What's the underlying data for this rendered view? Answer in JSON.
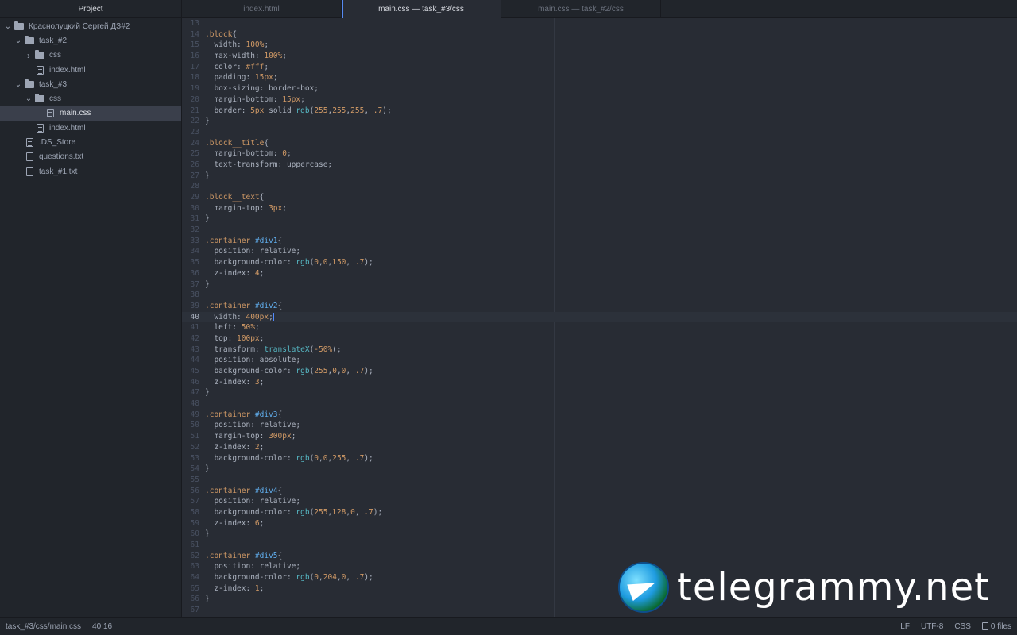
{
  "sidebar": {
    "title": "Project",
    "tree": [
      {
        "label": "Краснолуцкий Сергей ДЗ#2",
        "type": "folder",
        "depth": 0,
        "expanded": true,
        "selected": false
      },
      {
        "label": "task_#2",
        "type": "folder",
        "depth": 1,
        "expanded": true,
        "selected": false
      },
      {
        "label": "css",
        "type": "folder",
        "depth": 2,
        "expanded": false,
        "selected": false
      },
      {
        "label": "index.html",
        "type": "file",
        "depth": 2,
        "selected": false
      },
      {
        "label": "task_#3",
        "type": "folder",
        "depth": 1,
        "expanded": true,
        "selected": false
      },
      {
        "label": "css",
        "type": "folder",
        "depth": 2,
        "expanded": true,
        "selected": false
      },
      {
        "label": "main.css",
        "type": "file",
        "depth": 3,
        "selected": true
      },
      {
        "label": "index.html",
        "type": "file",
        "depth": 2,
        "selected": false
      },
      {
        "label": ".DS_Store",
        "type": "file",
        "depth": 1,
        "selected": false
      },
      {
        "label": "questions.txt",
        "type": "file",
        "depth": 1,
        "selected": false
      },
      {
        "label": "task_#1.txt",
        "type": "file",
        "depth": 1,
        "selected": false
      }
    ]
  },
  "tabs": [
    {
      "label": "index.html",
      "active": false
    },
    {
      "label": "main.css — task_#3/css",
      "active": true
    },
    {
      "label": "main.css — task_#2/css",
      "active": false
    }
  ],
  "editor": {
    "cursor_line": 40,
    "lines": [
      {
        "n": "13",
        "t": []
      },
      {
        "n": "14",
        "t": [
          [
            "sel",
            ".block"
          ],
          [
            "p",
            "{"
          ]
        ]
      },
      {
        "n": "15",
        "t": [
          [
            "prop",
            "  width: "
          ],
          [
            "num",
            "100%"
          ],
          [
            "p",
            ";"
          ]
        ]
      },
      {
        "n": "16",
        "t": [
          [
            "prop",
            "  max-width: "
          ],
          [
            "num",
            "100%"
          ],
          [
            "p",
            ";"
          ]
        ]
      },
      {
        "n": "17",
        "t": [
          [
            "prop",
            "  color: "
          ],
          [
            "num",
            "#fff"
          ],
          [
            "p",
            ";"
          ]
        ]
      },
      {
        "n": "18",
        "t": [
          [
            "prop",
            "  padding: "
          ],
          [
            "num",
            "15px"
          ],
          [
            "p",
            ";"
          ]
        ]
      },
      {
        "n": "19",
        "t": [
          [
            "prop",
            "  box-sizing: border-box;"
          ]
        ]
      },
      {
        "n": "20",
        "t": [
          [
            "prop",
            "  margin-bottom: "
          ],
          [
            "num",
            "15px"
          ],
          [
            "p",
            ";"
          ]
        ]
      },
      {
        "n": "21",
        "t": [
          [
            "prop",
            "  border: "
          ],
          [
            "num",
            "5px"
          ],
          [
            "prop",
            " solid "
          ],
          [
            "fn",
            "rgb"
          ],
          [
            "p",
            "("
          ],
          [
            "num",
            "255"
          ],
          [
            "p",
            ","
          ],
          [
            "num",
            "255"
          ],
          [
            "p",
            ","
          ],
          [
            "num",
            "255"
          ],
          [
            "p",
            ", "
          ],
          [
            "num",
            ".7"
          ],
          [
            "p",
            ");"
          ]
        ]
      },
      {
        "n": "22",
        "t": [
          [
            "p",
            "}"
          ]
        ]
      },
      {
        "n": "23",
        "t": []
      },
      {
        "n": "24",
        "t": [
          [
            "sel",
            ".block__title"
          ],
          [
            "p",
            "{"
          ]
        ]
      },
      {
        "n": "25",
        "t": [
          [
            "prop",
            "  margin-bottom: "
          ],
          [
            "num",
            "0"
          ],
          [
            "p",
            ";"
          ]
        ]
      },
      {
        "n": "26",
        "t": [
          [
            "prop",
            "  text-transform: uppercase;"
          ]
        ]
      },
      {
        "n": "27",
        "t": [
          [
            "p",
            "}"
          ]
        ]
      },
      {
        "n": "28",
        "t": []
      },
      {
        "n": "29",
        "t": [
          [
            "sel",
            ".block__text"
          ],
          [
            "p",
            "{"
          ]
        ]
      },
      {
        "n": "30",
        "t": [
          [
            "prop",
            "  margin-top: "
          ],
          [
            "num",
            "3px"
          ],
          [
            "p",
            ";"
          ]
        ]
      },
      {
        "n": "31",
        "t": [
          [
            "p",
            "}"
          ]
        ]
      },
      {
        "n": "32",
        "t": []
      },
      {
        "n": "33",
        "t": [
          [
            "sel",
            ".container "
          ],
          [
            "id",
            "#div1"
          ],
          [
            "p",
            "{"
          ]
        ]
      },
      {
        "n": "34",
        "t": [
          [
            "prop",
            "  position: relative;"
          ]
        ]
      },
      {
        "n": "35",
        "t": [
          [
            "prop",
            "  background-color: "
          ],
          [
            "fn",
            "rgb"
          ],
          [
            "p",
            "("
          ],
          [
            "num",
            "0"
          ],
          [
            "p",
            ","
          ],
          [
            "num",
            "0"
          ],
          [
            "p",
            ","
          ],
          [
            "num",
            "150"
          ],
          [
            "p",
            ", "
          ],
          [
            "num",
            ".7"
          ],
          [
            "p",
            ");"
          ]
        ]
      },
      {
        "n": "36",
        "t": [
          [
            "prop",
            "  z-index: "
          ],
          [
            "num",
            "4"
          ],
          [
            "p",
            ";"
          ]
        ]
      },
      {
        "n": "37",
        "t": [
          [
            "p",
            "}"
          ]
        ]
      },
      {
        "n": "38",
        "t": []
      },
      {
        "n": "39",
        "t": [
          [
            "sel",
            ".container "
          ],
          [
            "id",
            "#div2"
          ],
          [
            "p",
            "{"
          ]
        ]
      },
      {
        "n": "40",
        "t": [
          [
            "prop",
            "  width: "
          ],
          [
            "num",
            "400px"
          ],
          [
            "p",
            ";"
          ]
        ],
        "cursor": true
      },
      {
        "n": "41",
        "t": [
          [
            "prop",
            "  left: "
          ],
          [
            "num",
            "50%"
          ],
          [
            "p",
            ";"
          ]
        ]
      },
      {
        "n": "42",
        "t": [
          [
            "prop",
            "  top: "
          ],
          [
            "num",
            "100px"
          ],
          [
            "p",
            ";"
          ]
        ]
      },
      {
        "n": "43",
        "t": [
          [
            "prop",
            "  transform: "
          ],
          [
            "fn",
            "translateX"
          ],
          [
            "p",
            "("
          ],
          [
            "num",
            "-50%"
          ],
          [
            "p",
            ");"
          ]
        ]
      },
      {
        "n": "44",
        "t": [
          [
            "prop",
            "  position: absolute;"
          ]
        ]
      },
      {
        "n": "45",
        "t": [
          [
            "prop",
            "  background-color: "
          ],
          [
            "fn",
            "rgb"
          ],
          [
            "p",
            "("
          ],
          [
            "num",
            "255"
          ],
          [
            "p",
            ","
          ],
          [
            "num",
            "0"
          ],
          [
            "p",
            ","
          ],
          [
            "num",
            "0"
          ],
          [
            "p",
            ", "
          ],
          [
            "num",
            ".7"
          ],
          [
            "p",
            ");"
          ]
        ]
      },
      {
        "n": "46",
        "t": [
          [
            "prop",
            "  z-index: "
          ],
          [
            "num",
            "3"
          ],
          [
            "p",
            ";"
          ]
        ]
      },
      {
        "n": "47",
        "t": [
          [
            "p",
            "}"
          ]
        ]
      },
      {
        "n": "48",
        "t": []
      },
      {
        "n": "49",
        "t": [
          [
            "sel",
            ".container "
          ],
          [
            "id",
            "#div3"
          ],
          [
            "p",
            "{"
          ]
        ]
      },
      {
        "n": "50",
        "t": [
          [
            "prop",
            "  position: relative;"
          ]
        ]
      },
      {
        "n": "51",
        "t": [
          [
            "prop",
            "  margin-top: "
          ],
          [
            "num",
            "300px"
          ],
          [
            "p",
            ";"
          ]
        ]
      },
      {
        "n": "52",
        "t": [
          [
            "prop",
            "  z-index: "
          ],
          [
            "num",
            "2"
          ],
          [
            "p",
            ";"
          ]
        ]
      },
      {
        "n": "53",
        "t": [
          [
            "prop",
            "  background-color: "
          ],
          [
            "fn",
            "rgb"
          ],
          [
            "p",
            "("
          ],
          [
            "num",
            "0"
          ],
          [
            "p",
            ","
          ],
          [
            "num",
            "0"
          ],
          [
            "p",
            ","
          ],
          [
            "num",
            "255"
          ],
          [
            "p",
            ", "
          ],
          [
            "num",
            ".7"
          ],
          [
            "p",
            ");"
          ]
        ]
      },
      {
        "n": "54",
        "t": [
          [
            "p",
            "}"
          ]
        ]
      },
      {
        "n": "55",
        "t": []
      },
      {
        "n": "56",
        "t": [
          [
            "sel",
            ".container "
          ],
          [
            "id",
            "#div4"
          ],
          [
            "p",
            "{"
          ]
        ]
      },
      {
        "n": "57",
        "t": [
          [
            "prop",
            "  position: relative;"
          ]
        ]
      },
      {
        "n": "58",
        "t": [
          [
            "prop",
            "  background-color: "
          ],
          [
            "fn",
            "rgb"
          ],
          [
            "p",
            "("
          ],
          [
            "num",
            "255"
          ],
          [
            "p",
            ","
          ],
          [
            "num",
            "128"
          ],
          [
            "p",
            ","
          ],
          [
            "num",
            "0"
          ],
          [
            "p",
            ", "
          ],
          [
            "num",
            ".7"
          ],
          [
            "p",
            ");"
          ]
        ]
      },
      {
        "n": "59",
        "t": [
          [
            "prop",
            "  z-index: "
          ],
          [
            "num",
            "6"
          ],
          [
            "p",
            ";"
          ]
        ]
      },
      {
        "n": "60",
        "t": [
          [
            "p",
            "}"
          ]
        ]
      },
      {
        "n": "61",
        "t": []
      },
      {
        "n": "62",
        "t": [
          [
            "sel",
            ".container "
          ],
          [
            "id",
            "#div5"
          ],
          [
            "p",
            "{"
          ]
        ]
      },
      {
        "n": "63",
        "t": [
          [
            "prop",
            "  position: relative;"
          ]
        ]
      },
      {
        "n": "64",
        "t": [
          [
            "prop",
            "  background-color: "
          ],
          [
            "fn",
            "rgb"
          ],
          [
            "p",
            "("
          ],
          [
            "num",
            "0"
          ],
          [
            "p",
            ","
          ],
          [
            "num",
            "204"
          ],
          [
            "p",
            ","
          ],
          [
            "num",
            "0"
          ],
          [
            "p",
            ", "
          ],
          [
            "num",
            ".7"
          ],
          [
            "p",
            ");"
          ]
        ]
      },
      {
        "n": "65",
        "t": [
          [
            "prop",
            "  z-index: "
          ],
          [
            "num",
            "1"
          ],
          [
            "p",
            ";"
          ]
        ]
      },
      {
        "n": "66",
        "t": [
          [
            "p",
            "}"
          ]
        ]
      },
      {
        "n": "67",
        "t": []
      }
    ]
  },
  "watermark": {
    "text": "telegrammy.net"
  },
  "statusbar": {
    "path": "task_#3/css/main.css",
    "position": "40:16",
    "line_ending": "LF",
    "encoding": "UTF-8",
    "grammar": "CSS",
    "files": "0 files"
  },
  "colors": {
    "accent": "#568af2",
    "selector": "#d19a66",
    "id": "#61afef",
    "number": "#d19a66",
    "function": "#56b6c2"
  }
}
